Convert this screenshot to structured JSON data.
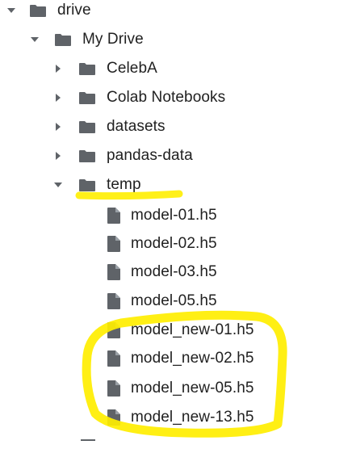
{
  "tree": {
    "root": {
      "label": "drive",
      "expanded": true
    },
    "my_drive": {
      "label": "My Drive",
      "expanded": true
    },
    "folders": [
      {
        "label": "CelebA",
        "expanded": false
      },
      {
        "label": "Colab Notebooks",
        "expanded": false
      },
      {
        "label": "datasets",
        "expanded": false
      },
      {
        "label": "pandas-data",
        "expanded": false
      },
      {
        "label": "temp",
        "expanded": true
      }
    ],
    "files": [
      {
        "label": "model-01.h5"
      },
      {
        "label": "model-02.h5"
      },
      {
        "label": "model-03.h5"
      },
      {
        "label": "model-05.h5"
      },
      {
        "label": "model_new-01.h5"
      },
      {
        "label": "model_new-02.h5"
      },
      {
        "label": "model_new-05.h5"
      },
      {
        "label": "model_new-13.h5"
      }
    ]
  },
  "icons": {
    "folder": "folder-icon",
    "file": "file-icon",
    "expanded": "caret-down-icon",
    "collapsed": "caret-right-icon"
  },
  "colors": {
    "icon": "#5f6368",
    "highlight": "#ffee00"
  }
}
